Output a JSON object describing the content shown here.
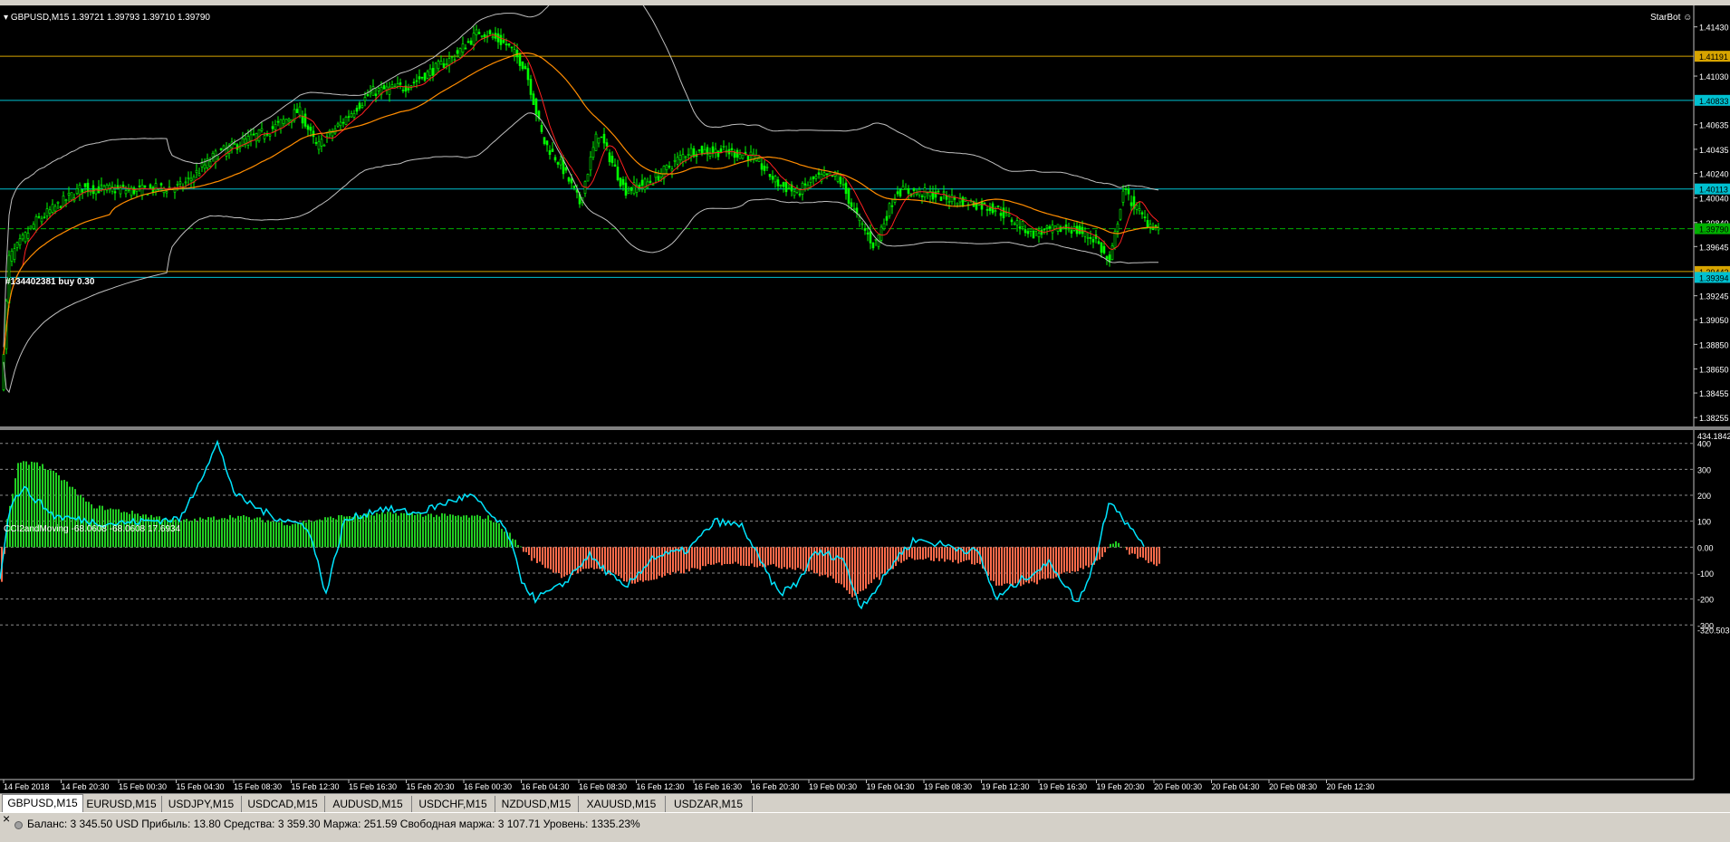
{
  "chart": {
    "header": "GBPUSD,M15  1.39721 1.39793 1.39710 1.39790",
    "expert": "StarBot",
    "order_label": "#134402381 buy 0.30",
    "indicator_header": "CCI2andMoving -68.0608 -68.0608 17.6934",
    "price_labels": [
      "1.41430",
      "1.41191",
      "1.41030",
      "1.40833",
      "1.40635",
      "1.40435",
      "1.40240",
      "1.40113",
      "1.40040",
      "1.39840",
      "1.39790",
      "1.39645",
      "1.39442",
      "1.39394",
      "1.39245",
      "1.39050",
      "1.38850",
      "1.38650",
      "1.38455",
      "1.38255"
    ],
    "osc_labels": [
      "434.1842",
      "400",
      "300",
      "200",
      "100",
      "0.00",
      "-100",
      "-200",
      "-300",
      "-320.503"
    ],
    "time_labels": [
      "14 Feb 2018",
      "14 Feb 20:30",
      "15 Feb 00:30",
      "15 Feb 04:30",
      "15 Feb 08:30",
      "15 Feb 12:30",
      "15 Feb 16:30",
      "15 Feb 20:30",
      "16 Feb 00:30",
      "16 Feb 04:30",
      "16 Feb 08:30",
      "16 Feb 12:30",
      "16 Feb 16:30",
      "16 Feb 20:30",
      "19 Feb 00:30",
      "19 Feb 04:30",
      "19 Feb 08:30",
      "19 Feb 12:30",
      "19 Feb 16:30",
      "19 Feb 20:30",
      "20 Feb 00:30",
      "20 Feb 04:30",
      "20 Feb 08:30",
      "20 Feb 12:30"
    ],
    "colors": {
      "candle": "#00ff00",
      "orange_line": "#d7a400",
      "cyan_line": "#00c0d0",
      "order_line": "#00b000",
      "band": "#c0c0c0",
      "ma_red": "#ff2020",
      "ma_orange": "#ff8c00",
      "cci": "#00e5ff",
      "hist_pos": "#22cc22",
      "hist_neg": "#ff6a4a"
    }
  },
  "tabs": [
    "GBPUSD,M15",
    "EURUSD,M15",
    "USDJPY,M15",
    "USDCAD,M15",
    "AUDUSD,M15",
    "USDCHF,M15",
    "NZDUSD,M15",
    "XAUUSD,M15",
    "USDZAR,M15"
  ],
  "status": {
    "close": "×",
    "text": "Баланс: 3 345.50 USD  Прибыль: 13.80  Средства: 3 359.30  Маржа: 251.59  Свободная маржа: 3 107.71  Уровень: 1335.23%"
  }
}
